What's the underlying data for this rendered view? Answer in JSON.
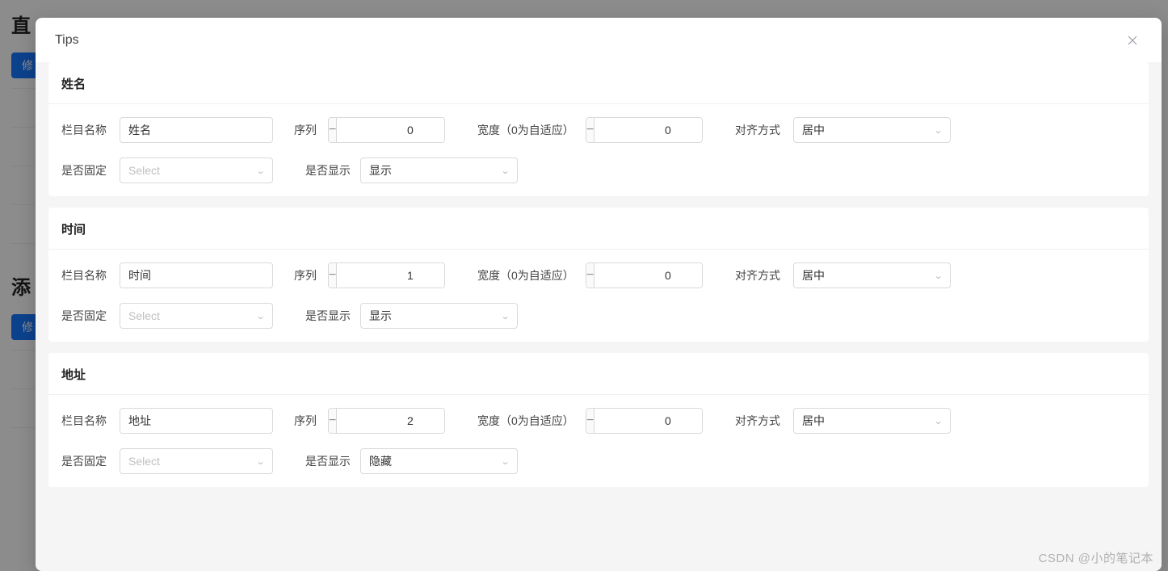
{
  "background": {
    "h1a": "直",
    "btn": "修",
    "h1b": "添",
    "btn2": "修"
  },
  "modal": {
    "title": "Tips"
  },
  "labels": {
    "columnName": "栏目名称",
    "order": "序列",
    "width": "宽度（0为自适应）",
    "align": "对齐方式",
    "fixed": "是否固定",
    "show": "是否显示"
  },
  "common": {
    "selectPlaceholder": "Select"
  },
  "panels": [
    {
      "title": "姓名",
      "columnName": "姓名",
      "order": "0",
      "width": "0",
      "align": "居中",
      "fixed": "",
      "show": "显示"
    },
    {
      "title": "时间",
      "columnName": "时间",
      "order": "1",
      "width": "0",
      "align": "居中",
      "fixed": "",
      "show": "显示"
    },
    {
      "title": "地址",
      "columnName": "地址",
      "order": "2",
      "width": "0",
      "align": "居中",
      "fixed": "",
      "show": "隐藏"
    }
  ],
  "watermark": "CSDN @小的笔记本"
}
